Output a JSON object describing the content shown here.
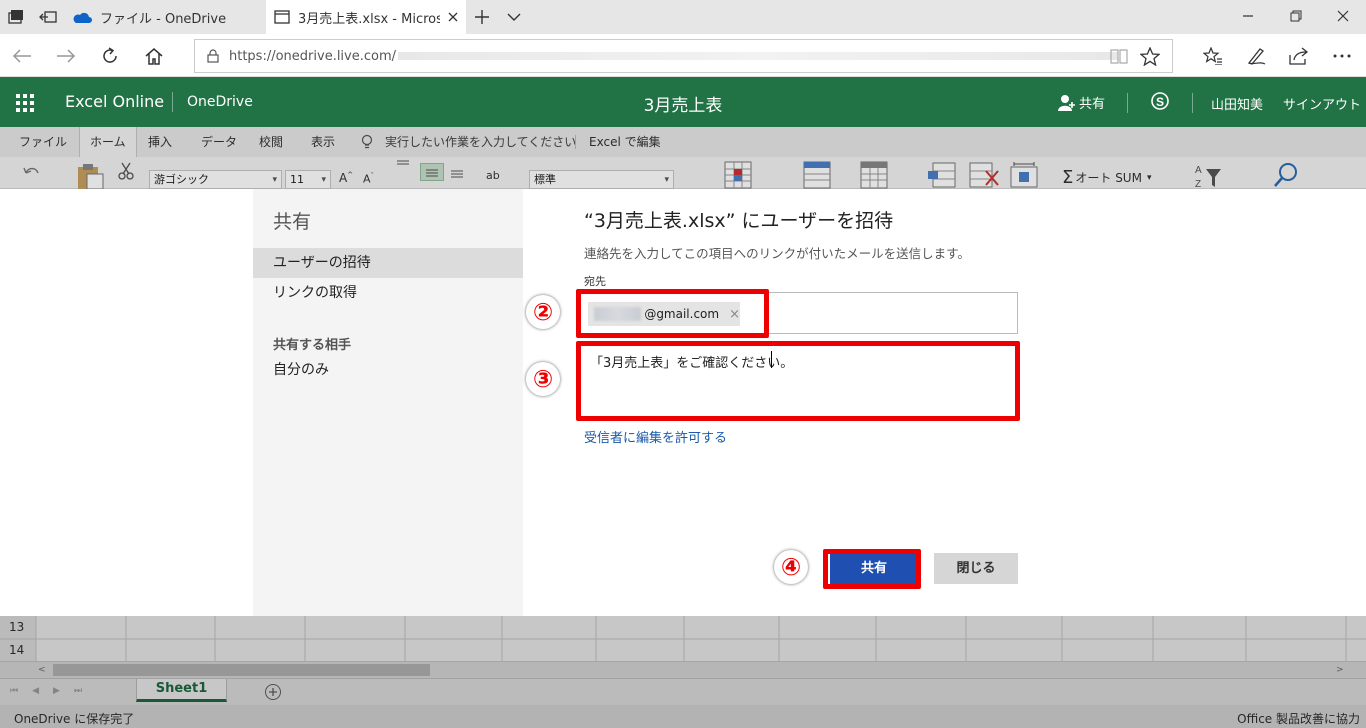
{
  "browser": {
    "tabs": [
      {
        "title": "ファイル - OneDrive"
      },
      {
        "title": "3月売上表.xlsx - Micros"
      }
    ],
    "url_prefix": "https://onedrive.live.com/"
  },
  "app": {
    "brand": "Excel Online",
    "service": "OneDrive",
    "doc_title": "3月売上表",
    "share_label": "共有",
    "user_name": "山田知美",
    "signout": "サインアウト"
  },
  "ribbon": {
    "tabs": [
      "ファイル",
      "ホーム",
      "挿入",
      "データ",
      "校閲",
      "表示"
    ],
    "tellme": "実行したい作業を入力してください",
    "edit_in_excel": "Excel で編集",
    "font_name": "游ゴシック",
    "font_size": "11",
    "number_format": "標準",
    "autosum": "オート SUM"
  },
  "dialog": {
    "side_title": "共有",
    "nav_invite": "ユーザーの招待",
    "nav_link": "リンクの取得",
    "shared_with_heading": "共有する相手",
    "shared_with_value": "自分のみ",
    "title": "“3月売上表.xlsx” にユーザーを招待",
    "subtitle": "連絡先を入力してこの項目へのリンクが付いたメールを送信します。",
    "to_label": "宛先",
    "recipient": "@gmail.com",
    "message": "「3月売上表」をご確認ください。",
    "allow_edit": "受信者に編集を許可する",
    "share_button": "共有",
    "close_button": "閉じる",
    "callouts": [
      "②",
      "③",
      "④"
    ]
  },
  "grid": {
    "rows": [
      "13",
      "14"
    ]
  },
  "sheets": {
    "active": "Sheet1"
  },
  "status": {
    "left": "OneDrive に保存完了",
    "right": "Office 製品改善に協力"
  }
}
